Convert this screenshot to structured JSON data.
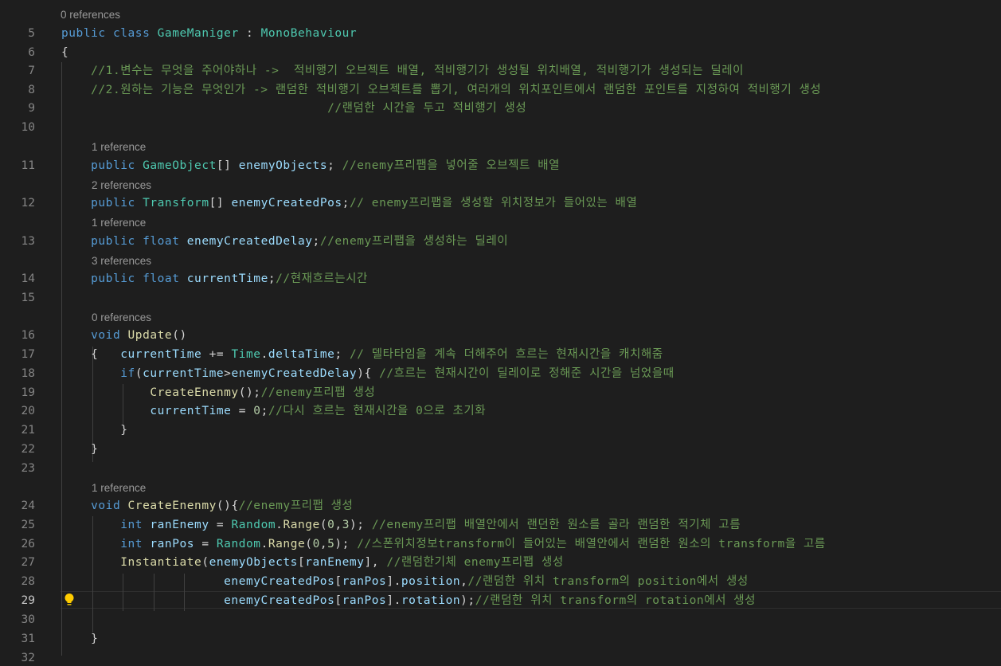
{
  "editor": {
    "colors": {
      "background": "#1e1e1e",
      "keyword": "#569cd6",
      "type": "#4ec9b0",
      "function": "#dcdcaa",
      "variable": "#9cdcfe",
      "comment": "#6a9955",
      "number": "#b5cea8",
      "plain": "#d4d4d4",
      "line_number": "#858585",
      "codelens": "#999999"
    },
    "active_line": "29",
    "lightbulb_icon": "lightbulb-icon",
    "codelens": [
      "0 references",
      "1 reference",
      "2 references",
      "1 reference",
      "3 references",
      "0 references",
      "1 reference"
    ],
    "line_numbers": [
      "5",
      "6",
      "7",
      "8",
      "9",
      "10",
      "11",
      "12",
      "13",
      "14",
      "15",
      "16",
      "17",
      "18",
      "19",
      "20",
      "21",
      "22",
      "23",
      "24",
      "25",
      "26",
      "27",
      "28",
      "29",
      "30",
      "31",
      "32"
    ],
    "lines": [
      [
        [
          "kw",
          "public"
        ],
        [
          "pl",
          " "
        ],
        [
          "kw",
          "class"
        ],
        [
          "pl",
          " "
        ],
        [
          "ty",
          "GameManiger"
        ],
        [
          "pl",
          " : "
        ],
        [
          "ty",
          "MonoBehaviour"
        ]
      ],
      [
        [
          "pl",
          "{"
        ]
      ],
      [
        [
          "cm",
          "    //1.변수는 무엇을 주어야하나 ->  적비행기 오브젝트 배열, 적비행기가 생성될 위치배열, 적비행기가 생성되는 딜레이"
        ]
      ],
      [
        [
          "cm",
          "    //2.원하는 기능은 무엇인가 -> 랜덤한 적비행기 오브젝트를 뽑기, 여러개의 위치포인트에서 랜덤한 포인트를 지정하여 적비행기 생성"
        ]
      ],
      [
        [
          "cm",
          "                                    //랜덤한 시간을 두고 적비행기 생성"
        ]
      ],
      [
        [
          "pl",
          ""
        ]
      ],
      [
        [
          "pl",
          "    "
        ],
        [
          "kw",
          "public"
        ],
        [
          "pl",
          " "
        ],
        [
          "ty",
          "GameObject"
        ],
        [
          "pl",
          "[] "
        ],
        [
          "vr",
          "enemyObjects"
        ],
        [
          "pl",
          "; "
        ],
        [
          "cm",
          "//enemy프리팹을 넣어줄 오브젝트 배열"
        ]
      ],
      [
        [
          "pl",
          "    "
        ],
        [
          "kw",
          "public"
        ],
        [
          "pl",
          " "
        ],
        [
          "ty",
          "Transform"
        ],
        [
          "pl",
          "[] "
        ],
        [
          "vr",
          "enemyCreatedPos"
        ],
        [
          "pl",
          ";"
        ],
        [
          "cm",
          "// enemy프리팹을 생성할 위치정보가 들어있는 배열"
        ]
      ],
      [
        [
          "pl",
          "    "
        ],
        [
          "kw",
          "public"
        ],
        [
          "pl",
          " "
        ],
        [
          "kw",
          "float"
        ],
        [
          "pl",
          " "
        ],
        [
          "vr",
          "enemyCreatedDelay"
        ],
        [
          "pl",
          ";"
        ],
        [
          "cm",
          "//enemy프리팹을 생성하는 딜레이"
        ]
      ],
      [
        [
          "pl",
          "    "
        ],
        [
          "kw",
          "public"
        ],
        [
          "pl",
          " "
        ],
        [
          "kw",
          "float"
        ],
        [
          "pl",
          " "
        ],
        [
          "vr",
          "currentTime"
        ],
        [
          "pl",
          ";"
        ],
        [
          "cm",
          "//현재흐르는시간"
        ]
      ],
      [
        [
          "pl",
          ""
        ]
      ],
      [
        [
          "pl",
          "    "
        ],
        [
          "kw",
          "void"
        ],
        [
          "pl",
          " "
        ],
        [
          "fn",
          "Update"
        ],
        [
          "pl",
          "()"
        ]
      ],
      [
        [
          "pl",
          "    {   "
        ],
        [
          "vr",
          "currentTime"
        ],
        [
          "pl",
          " += "
        ],
        [
          "ty",
          "Time"
        ],
        [
          "pl",
          "."
        ],
        [
          "vr",
          "deltaTime"
        ],
        [
          "pl",
          "; "
        ],
        [
          "cm",
          "// 델타타임을 계속 더해주어 흐르는 현재시간을 캐치해줌"
        ]
      ],
      [
        [
          "pl",
          "        "
        ],
        [
          "kw",
          "if"
        ],
        [
          "pl",
          "("
        ],
        [
          "vr",
          "currentTime"
        ],
        [
          "pl",
          ">"
        ],
        [
          "vr",
          "enemyCreatedDelay"
        ],
        [
          "pl",
          ")"
        ],
        [
          "pl",
          "{ "
        ],
        [
          "cm",
          "//흐르는 현재시간이 딜레이로 정해준 시간을 넘었을때"
        ]
      ],
      [
        [
          "pl",
          "            "
        ],
        [
          "fn",
          "CreateEnenmy"
        ],
        [
          "pl",
          "();"
        ],
        [
          "cm",
          "//enemy프리팹 생성"
        ]
      ],
      [
        [
          "pl",
          "            "
        ],
        [
          "vr",
          "currentTime"
        ],
        [
          "pl",
          " = "
        ],
        [
          "nm",
          "0"
        ],
        [
          "pl",
          ";"
        ],
        [
          "cm",
          "//다시 흐르는 현재시간을 0으로 초기화"
        ]
      ],
      [
        [
          "pl",
          "        }"
        ]
      ],
      [
        [
          "pl",
          "    }"
        ]
      ],
      [
        [
          "pl",
          ""
        ]
      ],
      [
        [
          "pl",
          "    "
        ],
        [
          "kw",
          "void"
        ],
        [
          "pl",
          " "
        ],
        [
          "fn",
          "CreateEnenmy"
        ],
        [
          "pl",
          "()"
        ],
        [
          "pl",
          "{"
        ],
        [
          "cm",
          "//enemy프리팹 생성"
        ]
      ],
      [
        [
          "pl",
          "        "
        ],
        [
          "kw",
          "int"
        ],
        [
          "pl",
          " "
        ],
        [
          "vr",
          "ranEnemy"
        ],
        [
          "pl",
          " = "
        ],
        [
          "ty",
          "Random"
        ],
        [
          "pl",
          "."
        ],
        [
          "fn",
          "Range"
        ],
        [
          "pl",
          "("
        ],
        [
          "nm",
          "0"
        ],
        [
          "pl",
          ","
        ],
        [
          "nm",
          "3"
        ],
        [
          "pl",
          "); "
        ],
        [
          "cm",
          "//enemy프리팹 배열안에서 랜던한 원소를 골라 랜덤한 적기체 고름"
        ]
      ],
      [
        [
          "pl",
          "        "
        ],
        [
          "kw",
          "int"
        ],
        [
          "pl",
          " "
        ],
        [
          "vr",
          "ranPos"
        ],
        [
          "pl",
          " = "
        ],
        [
          "ty",
          "Random"
        ],
        [
          "pl",
          "."
        ],
        [
          "fn",
          "Range"
        ],
        [
          "pl",
          "("
        ],
        [
          "nm",
          "0"
        ],
        [
          "pl",
          ","
        ],
        [
          "nm",
          "5"
        ],
        [
          "pl",
          "); "
        ],
        [
          "cm",
          "//스폰위치정보transform이 들어있는 배열안에서 랜덤한 원소의 transform을 고름"
        ]
      ],
      [
        [
          "pl",
          "        "
        ],
        [
          "fn",
          "Instantiate"
        ],
        [
          "pl",
          "("
        ],
        [
          "vr",
          "enemyObjects"
        ],
        [
          "pl",
          "["
        ],
        [
          "vr",
          "ranEnemy"
        ],
        [
          "pl",
          "], "
        ],
        [
          "cm",
          "//랜덤한기체 enemy프리팹 생성"
        ]
      ],
      [
        [
          "pl",
          "                      "
        ],
        [
          "vr",
          "enemyCreatedPos"
        ],
        [
          "pl",
          "["
        ],
        [
          "vr",
          "ranPos"
        ],
        [
          "pl",
          "]."
        ],
        [
          "vr",
          "position"
        ],
        [
          "pl",
          ","
        ],
        [
          "cm",
          "//랜덤한 위치 transform의 position에서 생성"
        ]
      ],
      [
        [
          "pl",
          "                      "
        ],
        [
          "vr",
          "enemyCreatedPos"
        ],
        [
          "pl",
          "["
        ],
        [
          "vr",
          "ranPos"
        ],
        [
          "pl",
          "]."
        ],
        [
          "vr",
          "rotation"
        ],
        [
          "pl",
          ");"
        ],
        [
          "cm",
          "//랜덤한 위치 transform의 rotation에서 생성"
        ]
      ],
      [
        [
          "pl",
          ""
        ]
      ],
      [
        [
          "pl",
          "    }"
        ]
      ],
      [
        [
          "pl",
          ""
        ]
      ]
    ]
  }
}
